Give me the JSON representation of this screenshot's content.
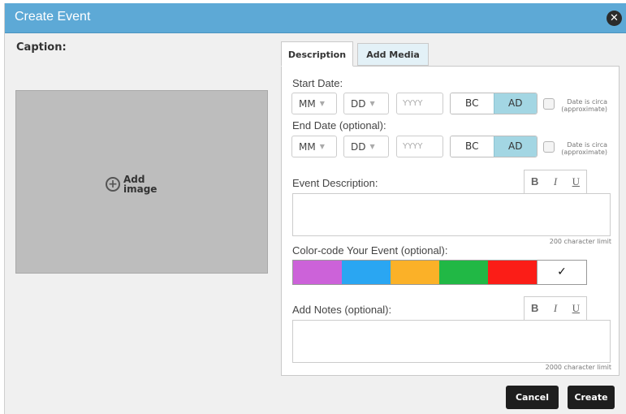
{
  "dialog": {
    "title": "Create Event",
    "close_icon": "close-icon"
  },
  "caption": {
    "label": "Caption:",
    "add_image_line1": "Add",
    "add_image_line2": "image",
    "add_icon": "plus-circle-icon"
  },
  "tabs": [
    {
      "label": "Description",
      "active": true
    },
    {
      "label": "Add Media",
      "active": false
    }
  ],
  "start_date": {
    "label": "Start Date:",
    "month": "MM",
    "day": "DD",
    "year_placeholder": "YYYY",
    "era_options": [
      "BC",
      "AD"
    ],
    "era_selected": "AD",
    "circa_line1": "Date is circa",
    "circa_line2": "(approximate)",
    "circa_checked": false
  },
  "end_date": {
    "label": "End Date (optional):",
    "month": "MM",
    "day": "DD",
    "year_placeholder": "YYYY",
    "era_options": [
      "BC",
      "AD"
    ],
    "era_selected": "AD",
    "circa_line1": "Date is circa",
    "circa_line2": "(approximate)",
    "circa_checked": false
  },
  "description": {
    "label": "Event Description:",
    "value": "",
    "limit": "200 character limit",
    "toolbar": {
      "bold": "B",
      "italic": "I",
      "underline": "U"
    }
  },
  "color_code": {
    "label": "Color-code Your Event (optional):",
    "colors": [
      "#cc62d9",
      "#2aa6f2",
      "#fbb128",
      "#21b845",
      "#fb1d17",
      "#ffffff"
    ],
    "selected_mark": "✓",
    "selected_index": 5
  },
  "notes": {
    "label": "Add Notes (optional):",
    "value": "",
    "limit": "2000 character limit",
    "toolbar": {
      "bold": "B",
      "italic": "I",
      "underline": "U"
    }
  },
  "buttons": {
    "cancel": "Cancel",
    "create": "Create"
  }
}
